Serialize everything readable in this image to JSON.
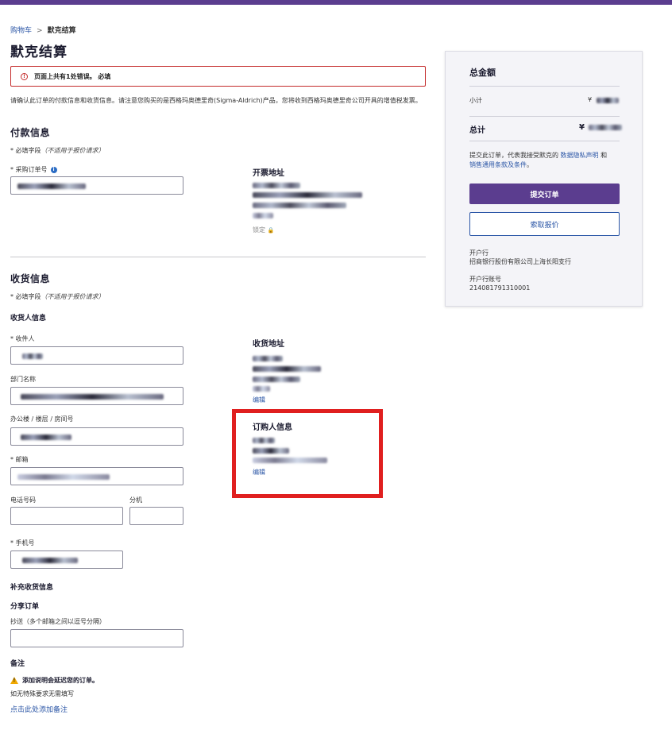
{
  "breadcrumb": {
    "cart": "购物车",
    "separator": ">",
    "current": "默克结算"
  },
  "page_title": "默克结算",
  "error_banner": {
    "icon": "!",
    "text": "页面上共有1处错误。 必填"
  },
  "intro_text": "请确认此订单的付款信息和收货信息。请注意您购买的是西格玛奥德里奇(Sigma-Aldrich)产品，您将收到西格玛奥德里奇公司开具的增值税发票。",
  "payment": {
    "heading": "付款信息",
    "required_note": "* 必填字段",
    "required_note_italic": "（不适用于报价请求）",
    "po_label": "* 采购订单号",
    "info_icon": "i",
    "billing_heading": "开票地址",
    "locked_label": "锁定",
    "lock_icon": "🔒"
  },
  "shipping": {
    "heading": "收货信息",
    "required_note": "* 必填字段",
    "required_note_italic": "（不适用于报价请求）",
    "recipient_heading": "收货人信息",
    "recipient_label": "* 收件人",
    "department_label": "部门名称",
    "office_label": "办公楼 / 楼层 / 房间号",
    "email_label": "* 邮箱",
    "phone_label": "电话号码",
    "ext_label": "分机",
    "mobile_label": "* 手机号",
    "shipping_address_heading": "收货地址",
    "edit_label": "编辑",
    "orderer_heading": "订购人信息",
    "orderer_edit_label": "编辑"
  },
  "supplementary": {
    "heading": "补充收货信息",
    "share_heading": "分享订单",
    "cc_label": "抄送（多个邮箱之间以逗号分隔）",
    "notes_heading": "备注",
    "warning_icon": "!",
    "warning_text": "添加说明会延迟您的订单。",
    "hint": "如无特殊要求无需填写",
    "add_note_link": "点击此处添加备注"
  },
  "summary": {
    "heading": "总金额",
    "subtotal_label": "小计",
    "subtotal_prefix": "¥",
    "total_label": "总计",
    "total_prefix": "¥",
    "terms_prefix": "提交此订单，代表我接受默克的 ",
    "privacy_link": "数据隐私声明",
    "terms_and": " 和",
    "sales_terms_link": "销售通用条款及条件",
    "terms_suffix": "。",
    "submit_button": "提交订单",
    "quote_button": "索取报价",
    "bank_label": "开户行",
    "bank_value": "招商银行股份有限公司上海长阳支行",
    "account_label": "开户行账号",
    "account_value": "214081791310001"
  },
  "colors": {
    "brand_purple": "#5b3d8f",
    "link_blue": "#2b56a6",
    "error_red": "#c42b2b",
    "highlight_red": "#e01f1f",
    "warning_amber": "#f0a800"
  }
}
